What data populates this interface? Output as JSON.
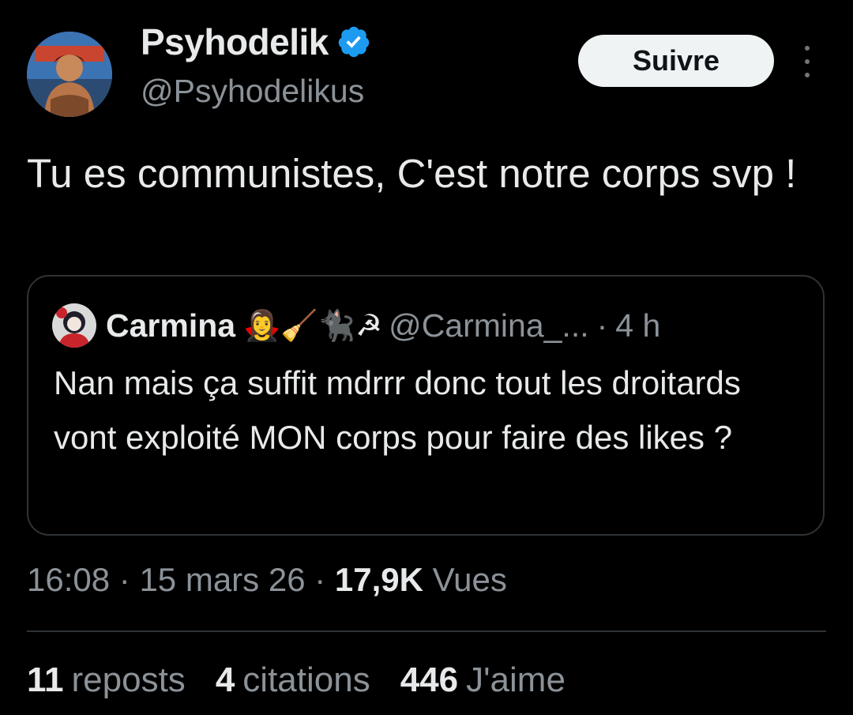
{
  "author": {
    "display_name": "Psyhodelik",
    "handle": "@Psyhodelikus",
    "verified": true
  },
  "follow_label": "Suivre",
  "tweet_text": "Tu es communistes, C'est notre corps svp !",
  "quoted": {
    "display_name": "Carmina",
    "name_emojis": "🧛‍♀️🧹🐈‍⬛☭",
    "handle": "@Carmina_...",
    "separator": "·",
    "time": "4 h",
    "text": "Nan mais ça suffit mdrrr donc tout les droitards vont exploité MON corps pour faire des likes ?"
  },
  "meta": {
    "time": "16:08",
    "dot1": "·",
    "date": "15 mars 26",
    "dot2": "·",
    "views_count": "17,9K",
    "views_label": "Vues"
  },
  "stats": {
    "reposts_count": "11",
    "reposts_label": "reposts",
    "quotes_count": "4",
    "quotes_label": "citations",
    "likes_count": "446",
    "likes_label": "J'aime"
  },
  "colors": {
    "background": "#000000",
    "text": "#e7e9ea",
    "secondary": "#8b9298",
    "verified": "#1d9bf0",
    "border": "#2f3336"
  }
}
